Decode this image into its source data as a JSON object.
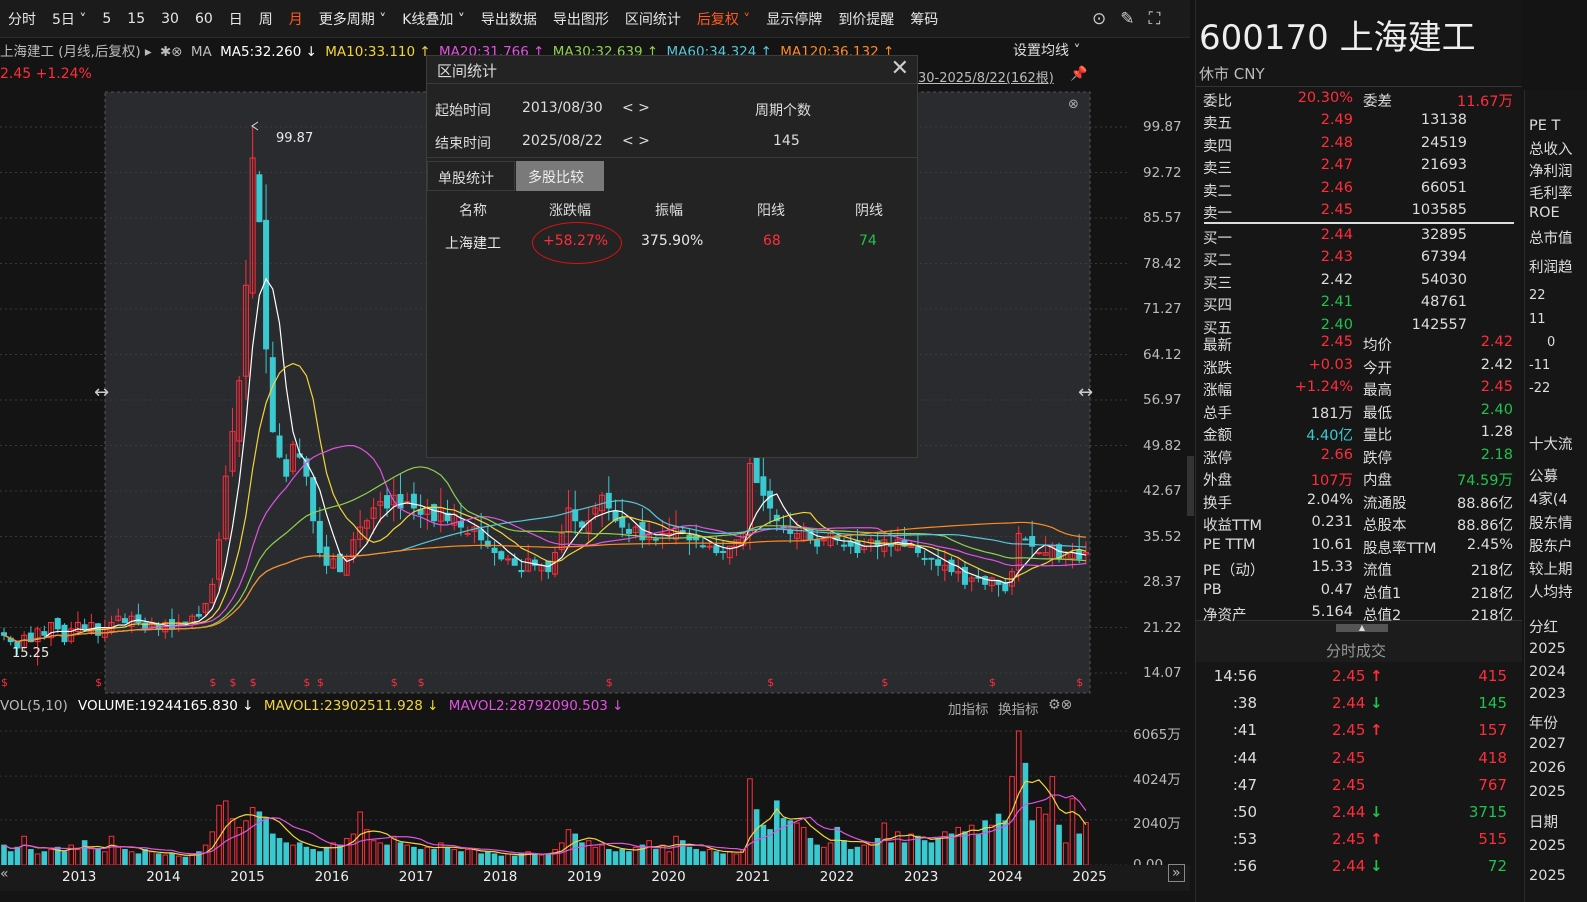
{
  "toolbar": {
    "items": [
      "分时",
      "5日 ˅",
      "5",
      "15",
      "30",
      "60",
      "日",
      "周",
      "月",
      "更多周期 ˅",
      "K线叠加 ˅",
      "导出数据",
      "导出图形",
      "区间统计",
      "后复权 ˅",
      "显示停牌",
      "到价提醒",
      "筹码"
    ],
    "active": [
      "月",
      "后复权 ˅"
    ]
  },
  "ma_bar": {
    "title": "上海建工 (月线,后复权) ▸",
    "ma_label": "MA",
    "ma5": "MA5:32.260 ↓",
    "ma10": "MA10:33.110 ↑",
    "ma20": "MA20:31.766 ↑",
    "ma30": "MA30:32.639 ↑",
    "ma60": "MA60:34.324 ↑",
    "ma120": "MA120:36.132 ↑",
    "settings": "设置均线 ˅"
  },
  "price_line": {
    "price": "2.45 +1.24%",
    "range": "30-2025/8/22(162根)"
  },
  "price_axis": [
    "99.87",
    "92.72",
    "85.57",
    "78.42",
    "71.27",
    "64.12",
    "56.97",
    "49.82",
    "42.67",
    "35.52",
    "28.37",
    "21.22",
    "14.07"
  ],
  "annotations": {
    "high": "99.87",
    "low": "15.25"
  },
  "colors": {
    "up": "#ff2d3a",
    "down": "#3bc9d0",
    "ma5": "#ffffff",
    "ma10": "#f2d43a",
    "ma20": "#e052e0",
    "ma30": "#8fd14f",
    "ma60": "#55c7d8",
    "ma120": "#ff8a1f"
  },
  "kline": {
    "closes": [
      20,
      19,
      18,
      20,
      19,
      21,
      20,
      22,
      21,
      19,
      21,
      22,
      21,
      22,
      20,
      21,
      22,
      23,
      22,
      23,
      22,
      21,
      22,
      21,
      22,
      21,
      22,
      22,
      23,
      23,
      25,
      28,
      35,
      45,
      52,
      60,
      75,
      95,
      85,
      65,
      52,
      48,
      45,
      50,
      48,
      45,
      38,
      33,
      31,
      32,
      30,
      32,
      35,
      37,
      38,
      40,
      41,
      40,
      42,
      40,
      41,
      40,
      39,
      40,
      38,
      40,
      38,
      39,
      37,
      36,
      37,
      35,
      34,
      33,
      32,
      32,
      31,
      30,
      32,
      31,
      31,
      30,
      33,
      36,
      40,
      38,
      37,
      38,
      40,
      42,
      40,
      38,
      37,
      36,
      37,
      35,
      36,
      35,
      36,
      36,
      37,
      36,
      35,
      35,
      34,
      34,
      33,
      33,
      34,
      35,
      36,
      47,
      44,
      42,
      40,
      38,
      37,
      36,
      36,
      37,
      35,
      34,
      35,
      36,
      35,
      34,
      34,
      33,
      34,
      35,
      34,
      35,
      34,
      35,
      34,
      34,
      33,
      32,
      32,
      31,
      31,
      30,
      30,
      28,
      29,
      29,
      28,
      29,
      28,
      27,
      30,
      36,
      35,
      34,
      33,
      33,
      34,
      32,
      33,
      33,
      32,
      33
    ],
    "volumes_wan": [
      900,
      600,
      800,
      1300,
      700,
      500,
      600,
      700,
      800,
      600,
      900,
      700,
      1100,
      800,
      700,
      600,
      1300,
      800,
      700,
      600,
      500,
      700,
      600,
      500,
      450,
      500,
      400,
      350,
      500,
      600,
      900,
      1500,
      2700,
      2900,
      2100,
      1700,
      2000,
      2600,
      2400,
      2100,
      1400,
      1200,
      1000,
      900,
      1000,
      800,
      700,
      600,
      800,
      1000,
      900,
      1200,
      1400,
      2400,
      1600,
      1100,
      1000,
      900,
      1300,
      1000,
      900,
      800,
      700,
      800,
      700,
      1000,
      800,
      700,
      600,
      700,
      700,
      500,
      600,
      500,
      400,
      500,
      400,
      500,
      600,
      500,
      450,
      500,
      700,
      1000,
      1600,
      1400,
      1000,
      1100,
      800,
      900,
      700,
      600,
      700,
      600,
      800,
      900,
      1100,
      700,
      900,
      600,
      1300,
      1100,
      800,
      700,
      600,
      700,
      600,
      500,
      600,
      500,
      700,
      3900,
      2500,
      1800,
      1600,
      2900,
      2100,
      2000,
      1900,
      1700,
      1200,
      900,
      800,
      1000,
      1700,
      1100,
      700,
      800,
      900,
      1000,
      1200,
      1900,
      1000,
      1500,
      1000,
      1400,
      1300,
      1100,
      1000,
      1200,
      1500,
      1400,
      1700,
      1500,
      1800,
      1400,
      2000,
      1800,
      2300,
      2000,
      4000,
      6065,
      4600,
      2000,
      2600,
      2300,
      4000,
      1800,
      1000,
      3000,
      1400,
      1924
    ]
  },
  "vol_bar": {
    "label": "VOL(5,10)",
    "volume": "VOLUME:19244165.830 ↓",
    "mavol1": "MAVOL1:23902511.928 ↓",
    "mavol2": "MAVOL2:28792090.503 ↓",
    "add": "加指标",
    "switch": "换指标"
  },
  "vol_axis": [
    "6065万",
    "4024万",
    "2040万",
    "0.00"
  ],
  "years": [
    "2013",
    "2014",
    "2015",
    "2016",
    "2017",
    "2018",
    "2019",
    "2020",
    "2021",
    "2022",
    "2023",
    "2024",
    "2025"
  ],
  "dialog": {
    "title": "区间统计",
    "start_label": "起始时间",
    "start": "2013/08/30",
    "end_label": "结束时间",
    "end": "2025/08/22",
    "nav": "< >",
    "period_label": "周期个数",
    "period": "145",
    "tabs": [
      "单股统计",
      "多股比较"
    ],
    "headers": [
      "名称",
      "涨跌幅",
      "振幅",
      "阳线",
      "阴线"
    ],
    "row": [
      "上海建工",
      "+58.27%",
      "375.90%",
      "68",
      "74"
    ]
  },
  "stock": {
    "title": "600170 上海建工",
    "status": "休市 CNY"
  },
  "quote": {
    "wb": [
      "委比",
      "20.30%",
      "委差",
      "11.67万"
    ],
    "asks": [
      [
        "卖五",
        "2.49",
        "13138"
      ],
      [
        "卖四",
        "2.48",
        "24519"
      ],
      [
        "卖三",
        "2.47",
        "21693"
      ],
      [
        "卖二",
        "2.46",
        "66051"
      ],
      [
        "卖一",
        "2.45",
        "103585"
      ]
    ],
    "bids": [
      [
        "买一",
        "2.44",
        "32895"
      ],
      [
        "买二",
        "2.43",
        "67394"
      ],
      [
        "买三",
        "2.42",
        "54030"
      ],
      [
        "买四",
        "2.41",
        "48761"
      ],
      [
        "买五",
        "2.40",
        "142557"
      ]
    ],
    "stats": [
      [
        "最新",
        "2.45",
        "均价",
        "2.42"
      ],
      [
        "涨跌",
        "+0.03",
        "今开",
        "2.42"
      ],
      [
        "涨幅",
        "+1.24%",
        "最高",
        "2.45"
      ],
      [
        "总手",
        "181万",
        "最低",
        "2.40"
      ],
      [
        "金额",
        "4.40亿",
        "量比",
        "1.28"
      ],
      [
        "涨停",
        "2.66",
        "跌停",
        "2.18"
      ],
      [
        "外盘",
        "107万",
        "内盘",
        "74.59万"
      ],
      [
        "换手",
        "2.04%",
        "流通股",
        "88.86亿"
      ],
      [
        "收益TTM",
        "0.231",
        "总股本",
        "88.86亿"
      ],
      [
        "PE TTM",
        "10.61",
        "股息率TTM",
        "2.45%"
      ],
      [
        "PE（动）",
        "15.33",
        "流值",
        "218亿"
      ],
      [
        "PB",
        "0.47",
        "总值1",
        "218亿"
      ],
      [
        "净资产",
        "5.164",
        "总值2",
        "218亿"
      ]
    ]
  },
  "ticks_title": "分时成交",
  "ticks": [
    [
      "14:56",
      "2.45",
      "↑",
      "415"
    ],
    [
      ":38",
      "2.44",
      "↓",
      "145"
    ],
    [
      ":41",
      "2.45",
      "↑",
      "157"
    ],
    [
      ":44",
      "2.45",
      "",
      "418"
    ],
    [
      ":47",
      "2.45",
      "",
      "767"
    ],
    [
      ":50",
      "2.44",
      "↓",
      "3715"
    ],
    [
      ":53",
      "2.45",
      "↑",
      "515"
    ],
    [
      ":56",
      "2.44",
      "↓",
      "72"
    ]
  ],
  "far": {
    "items": [
      "PE T",
      "总收入",
      "净利润",
      "毛利率",
      "ROE",
      "总市值",
      "利润趋",
      "22",
      "11",
      "0",
      "-11",
      "-22",
      "十大流",
      "公募",
      "4家(4",
      "股东情",
      "股东户",
      "较上期",
      "人均持",
      "分红",
      "2025",
      "2024",
      "2023",
      "年份",
      "2027",
      "2026",
      "2025",
      "日期",
      "2025",
      "2025"
    ]
  }
}
